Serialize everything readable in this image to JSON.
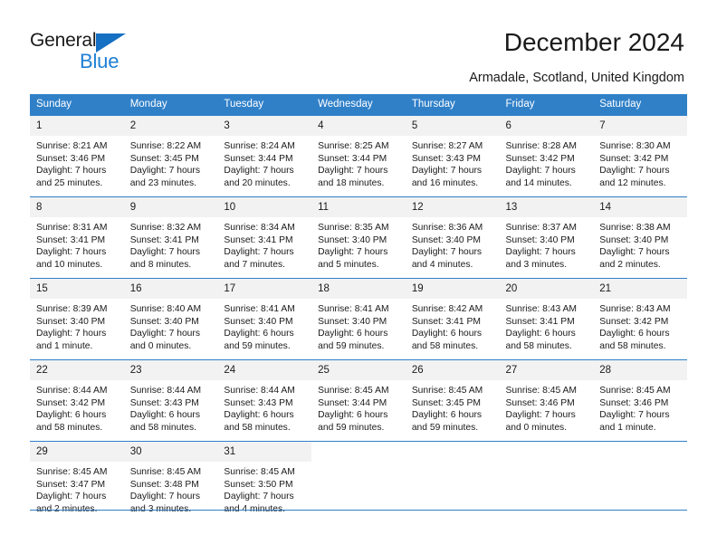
{
  "brand": {
    "name_dark": "General",
    "name_blue": "Blue",
    "accent_color": "#1c7fd4",
    "header_color": "#3080c8"
  },
  "header": {
    "title": "December 2024",
    "subtitle": "Armadale, Scotland, United Kingdom"
  },
  "weekdays": [
    "Sunday",
    "Monday",
    "Tuesday",
    "Wednesday",
    "Thursday",
    "Friday",
    "Saturday"
  ],
  "weeks": [
    [
      {
        "day": "1",
        "sunrise": "Sunrise: 8:21 AM",
        "sunset": "Sunset: 3:46 PM",
        "daylight1": "Daylight: 7 hours",
        "daylight2": "and 25 minutes."
      },
      {
        "day": "2",
        "sunrise": "Sunrise: 8:22 AM",
        "sunset": "Sunset: 3:45 PM",
        "daylight1": "Daylight: 7 hours",
        "daylight2": "and 23 minutes."
      },
      {
        "day": "3",
        "sunrise": "Sunrise: 8:24 AM",
        "sunset": "Sunset: 3:44 PM",
        "daylight1": "Daylight: 7 hours",
        "daylight2": "and 20 minutes."
      },
      {
        "day": "4",
        "sunrise": "Sunrise: 8:25 AM",
        "sunset": "Sunset: 3:44 PM",
        "daylight1": "Daylight: 7 hours",
        "daylight2": "and 18 minutes."
      },
      {
        "day": "5",
        "sunrise": "Sunrise: 8:27 AM",
        "sunset": "Sunset: 3:43 PM",
        "daylight1": "Daylight: 7 hours",
        "daylight2": "and 16 minutes."
      },
      {
        "day": "6",
        "sunrise": "Sunrise: 8:28 AM",
        "sunset": "Sunset: 3:42 PM",
        "daylight1": "Daylight: 7 hours",
        "daylight2": "and 14 minutes."
      },
      {
        "day": "7",
        "sunrise": "Sunrise: 8:30 AM",
        "sunset": "Sunset: 3:42 PM",
        "daylight1": "Daylight: 7 hours",
        "daylight2": "and 12 minutes."
      }
    ],
    [
      {
        "day": "8",
        "sunrise": "Sunrise: 8:31 AM",
        "sunset": "Sunset: 3:41 PM",
        "daylight1": "Daylight: 7 hours",
        "daylight2": "and 10 minutes."
      },
      {
        "day": "9",
        "sunrise": "Sunrise: 8:32 AM",
        "sunset": "Sunset: 3:41 PM",
        "daylight1": "Daylight: 7 hours",
        "daylight2": "and 8 minutes."
      },
      {
        "day": "10",
        "sunrise": "Sunrise: 8:34 AM",
        "sunset": "Sunset: 3:41 PM",
        "daylight1": "Daylight: 7 hours",
        "daylight2": "and 7 minutes."
      },
      {
        "day": "11",
        "sunrise": "Sunrise: 8:35 AM",
        "sunset": "Sunset: 3:40 PM",
        "daylight1": "Daylight: 7 hours",
        "daylight2": "and 5 minutes."
      },
      {
        "day": "12",
        "sunrise": "Sunrise: 8:36 AM",
        "sunset": "Sunset: 3:40 PM",
        "daylight1": "Daylight: 7 hours",
        "daylight2": "and 4 minutes."
      },
      {
        "day": "13",
        "sunrise": "Sunrise: 8:37 AM",
        "sunset": "Sunset: 3:40 PM",
        "daylight1": "Daylight: 7 hours",
        "daylight2": "and 3 minutes."
      },
      {
        "day": "14",
        "sunrise": "Sunrise: 8:38 AM",
        "sunset": "Sunset: 3:40 PM",
        "daylight1": "Daylight: 7 hours",
        "daylight2": "and 2 minutes."
      }
    ],
    [
      {
        "day": "15",
        "sunrise": "Sunrise: 8:39 AM",
        "sunset": "Sunset: 3:40 PM",
        "daylight1": "Daylight: 7 hours",
        "daylight2": "and 1 minute."
      },
      {
        "day": "16",
        "sunrise": "Sunrise: 8:40 AM",
        "sunset": "Sunset: 3:40 PM",
        "daylight1": "Daylight: 7 hours",
        "daylight2": "and 0 minutes."
      },
      {
        "day": "17",
        "sunrise": "Sunrise: 8:41 AM",
        "sunset": "Sunset: 3:40 PM",
        "daylight1": "Daylight: 6 hours",
        "daylight2": "and 59 minutes."
      },
      {
        "day": "18",
        "sunrise": "Sunrise: 8:41 AM",
        "sunset": "Sunset: 3:40 PM",
        "daylight1": "Daylight: 6 hours",
        "daylight2": "and 59 minutes."
      },
      {
        "day": "19",
        "sunrise": "Sunrise: 8:42 AM",
        "sunset": "Sunset: 3:41 PM",
        "daylight1": "Daylight: 6 hours",
        "daylight2": "and 58 minutes."
      },
      {
        "day": "20",
        "sunrise": "Sunrise: 8:43 AM",
        "sunset": "Sunset: 3:41 PM",
        "daylight1": "Daylight: 6 hours",
        "daylight2": "and 58 minutes."
      },
      {
        "day": "21",
        "sunrise": "Sunrise: 8:43 AM",
        "sunset": "Sunset: 3:42 PM",
        "daylight1": "Daylight: 6 hours",
        "daylight2": "and 58 minutes."
      }
    ],
    [
      {
        "day": "22",
        "sunrise": "Sunrise: 8:44 AM",
        "sunset": "Sunset: 3:42 PM",
        "daylight1": "Daylight: 6 hours",
        "daylight2": "and 58 minutes."
      },
      {
        "day": "23",
        "sunrise": "Sunrise: 8:44 AM",
        "sunset": "Sunset: 3:43 PM",
        "daylight1": "Daylight: 6 hours",
        "daylight2": "and 58 minutes."
      },
      {
        "day": "24",
        "sunrise": "Sunrise: 8:44 AM",
        "sunset": "Sunset: 3:43 PM",
        "daylight1": "Daylight: 6 hours",
        "daylight2": "and 58 minutes."
      },
      {
        "day": "25",
        "sunrise": "Sunrise: 8:45 AM",
        "sunset": "Sunset: 3:44 PM",
        "daylight1": "Daylight: 6 hours",
        "daylight2": "and 59 minutes."
      },
      {
        "day": "26",
        "sunrise": "Sunrise: 8:45 AM",
        "sunset": "Sunset: 3:45 PM",
        "daylight1": "Daylight: 6 hours",
        "daylight2": "and 59 minutes."
      },
      {
        "day": "27",
        "sunrise": "Sunrise: 8:45 AM",
        "sunset": "Sunset: 3:46 PM",
        "daylight1": "Daylight: 7 hours",
        "daylight2": "and 0 minutes."
      },
      {
        "day": "28",
        "sunrise": "Sunrise: 8:45 AM",
        "sunset": "Sunset: 3:46 PM",
        "daylight1": "Daylight: 7 hours",
        "daylight2": "and 1 minute."
      }
    ],
    [
      {
        "day": "29",
        "sunrise": "Sunrise: 8:45 AM",
        "sunset": "Sunset: 3:47 PM",
        "daylight1": "Daylight: 7 hours",
        "daylight2": "and 2 minutes."
      },
      {
        "day": "30",
        "sunrise": "Sunrise: 8:45 AM",
        "sunset": "Sunset: 3:48 PM",
        "daylight1": "Daylight: 7 hours",
        "daylight2": "and 3 minutes."
      },
      {
        "day": "31",
        "sunrise": "Sunrise: 8:45 AM",
        "sunset": "Sunset: 3:50 PM",
        "daylight1": "Daylight: 7 hours",
        "daylight2": "and 4 minutes."
      },
      {
        "day": "",
        "sunrise": "",
        "sunset": "",
        "daylight1": "",
        "daylight2": ""
      },
      {
        "day": "",
        "sunrise": "",
        "sunset": "",
        "daylight1": "",
        "daylight2": ""
      },
      {
        "day": "",
        "sunrise": "",
        "sunset": "",
        "daylight1": "",
        "daylight2": ""
      },
      {
        "day": "",
        "sunrise": "",
        "sunset": "",
        "daylight1": "",
        "daylight2": ""
      }
    ]
  ]
}
